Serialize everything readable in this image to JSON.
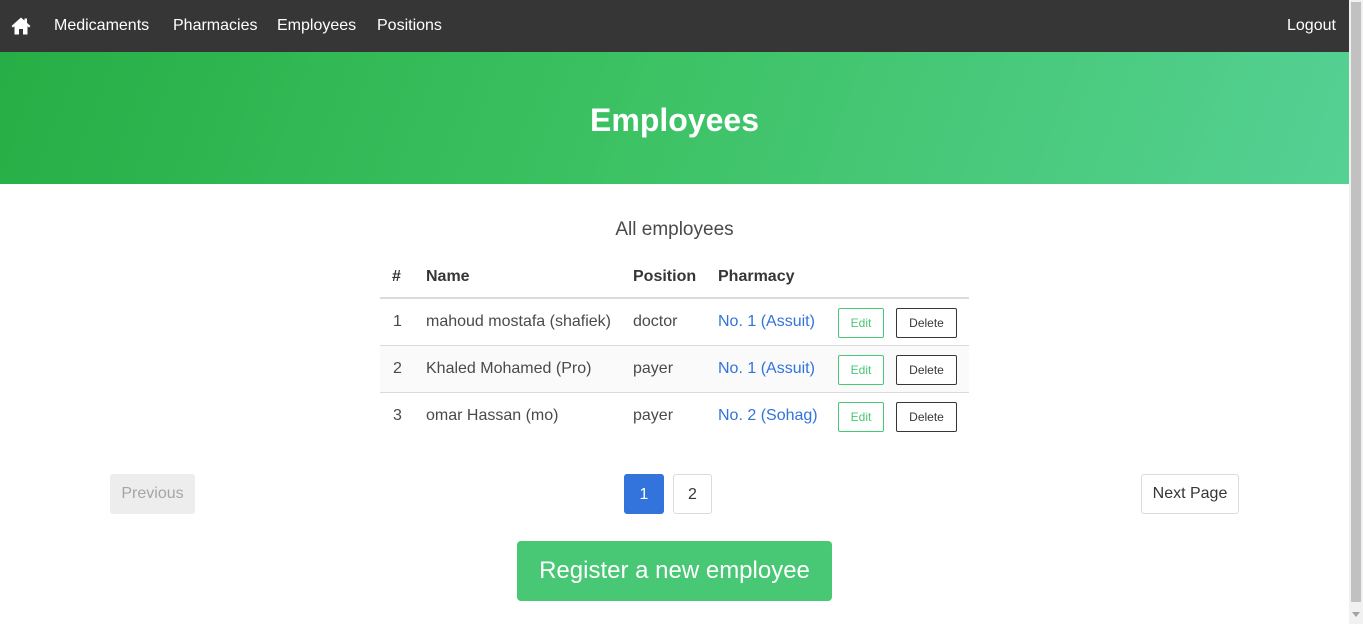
{
  "nav": {
    "home_icon": "home-icon",
    "links": [
      "Medicaments",
      "Pharmacies",
      "Employees",
      "Positions"
    ],
    "logout": "Logout"
  },
  "hero": {
    "title": "Employees"
  },
  "section": {
    "subtitle": "All employees"
  },
  "table": {
    "headers": [
      "#",
      "Name",
      "Position",
      "Pharmacy"
    ],
    "rows": [
      {
        "num": "1",
        "name": "mahoud mostafa (shafiek)",
        "position": "doctor",
        "pharmacy": "No. 1 (Assuit)",
        "edit": "Edit",
        "delete": "Delete"
      },
      {
        "num": "2",
        "name": "Khaled Mohamed (Pro)",
        "position": "payer",
        "pharmacy": "No. 1 (Assuit)",
        "edit": "Edit",
        "delete": "Delete"
      },
      {
        "num": "3",
        "name": "omar Hassan (mo)",
        "position": "payer",
        "pharmacy": "No. 2 (Sohag)",
        "edit": "Edit",
        "delete": "Delete"
      }
    ]
  },
  "pagination": {
    "previous": "Previous",
    "pages": [
      "1",
      "2"
    ],
    "current_page": "1",
    "next": "Next Page"
  },
  "actions": {
    "register": "Register a new employee"
  },
  "colors": {
    "navbar": "#363636",
    "hero_start": "#27ae45",
    "hero_end": "#55d194",
    "success": "#48c774",
    "link": "#3273dc"
  }
}
